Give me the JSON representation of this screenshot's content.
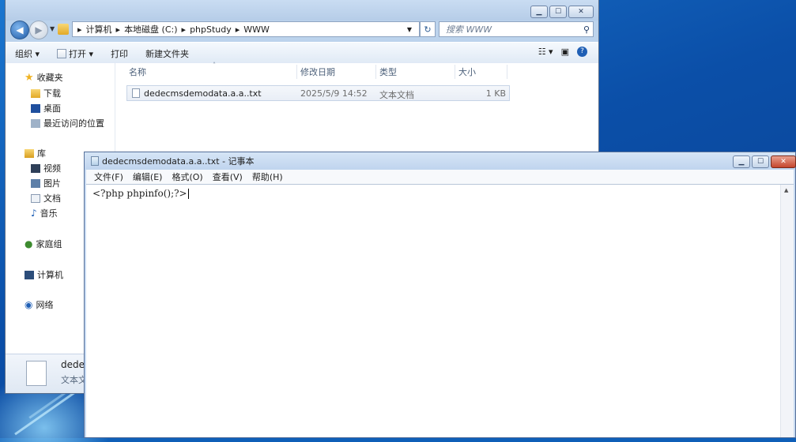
{
  "explorer": {
    "address_segments": [
      "计算机",
      "本地磁盘 (C:)",
      "phpStudy",
      "WWW"
    ],
    "search_placeholder": "搜索 WWW",
    "toolbar": {
      "organize": "组织 ▾",
      "open": "打开 ▾",
      "print": "打印",
      "new_folder": "新建文件夹"
    },
    "nav": {
      "favorites": "收藏夹",
      "downloads": "下载",
      "desktop": "桌面",
      "recent": "最近访问的位置",
      "library": "库",
      "videos": "视频",
      "pictures": "图片",
      "documents": "文档",
      "music": "音乐",
      "homegroup": "家庭组",
      "computer": "计算机",
      "network": "网络"
    },
    "columns": {
      "name": "名称",
      "modified": "修改日期",
      "type": "类型",
      "size": "大小"
    },
    "files": [
      {
        "name": "dedecmsdemodata.a.a..txt",
        "modified": "2025/5/9 14:52",
        "type": "文本文档",
        "size": "1 KB"
      }
    ],
    "details": {
      "name": "dedec",
      "type": "文本文"
    }
  },
  "notepad": {
    "title": "dedecmsdemodata.a.a..txt - 记事本",
    "menu": [
      "文件(F)",
      "编辑(E)",
      "格式(O)",
      "查看(V)",
      "帮助(H)"
    ],
    "content": "<?php phpinfo();?>"
  }
}
